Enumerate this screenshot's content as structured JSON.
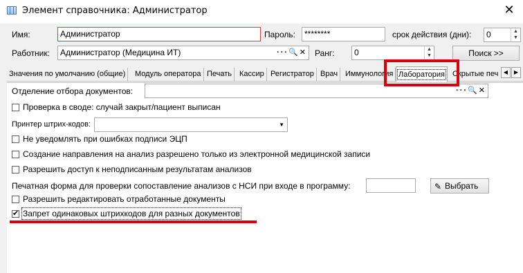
{
  "window": {
    "title": "Элемент справочника: Администратор",
    "close_glyph": "✕"
  },
  "form": {
    "name_label": "Имя:",
    "name_value": "Администратор",
    "password_label": "Пароль:",
    "password_value": "********",
    "validity_label": "срок действия (дни):",
    "validity_value": "0",
    "worker_label": "Работник:",
    "worker_value": "Администратор (Медицина ИТ)",
    "rank_label": "Ранг:",
    "rank_value": "0",
    "search_button": "Поиск  >>",
    "lookup_icons": "···🔍✕"
  },
  "tabs": [
    {
      "label": "Значения по умолчанию (общие)"
    },
    {
      "label": "Модуль оператора"
    },
    {
      "label": "Печать"
    },
    {
      "label": "Кассир"
    },
    {
      "label": "Регистратор"
    },
    {
      "label": "Врач"
    },
    {
      "label": "Иммунология"
    },
    {
      "label": "Лаборатория",
      "active": true
    },
    {
      "label": "Скрытые печ"
    }
  ],
  "lab": {
    "dept_label": "Отделение отбора документов:",
    "dept_value": "",
    "check_summary": "Проверка в своде: случай закрыт/пациент выписан",
    "printer_label": "Принтер штрих-кодов:",
    "printer_value": "",
    "no_notify_ecp": "Не уведомлять при ошибках подписи ЭЦП",
    "create_direction": "Создание направления на анализ разрешено только из электронной медицинской записи",
    "allow_unsigned": "Разрешить доступ к неподписанным результатам анализов",
    "print_form_label": "Печатная форма для проверки сопоставление анализов с НСИ при входе в программу:",
    "print_form_value": "",
    "choose_button": "Выбрать",
    "allow_edit": "Разрешить редактировать отработанные документы",
    "forbid_same_barcodes": "Запрет одинаковых штрихкодов для разных документов"
  },
  "checkbox_state": {
    "check_summary": false,
    "no_notify_ecp": false,
    "create_direction": false,
    "allow_unsigned": false,
    "allow_edit": false,
    "forbid_same_barcodes": true
  },
  "colors": {
    "highlight": "#d9000e",
    "panel": "#f0f0f0"
  }
}
